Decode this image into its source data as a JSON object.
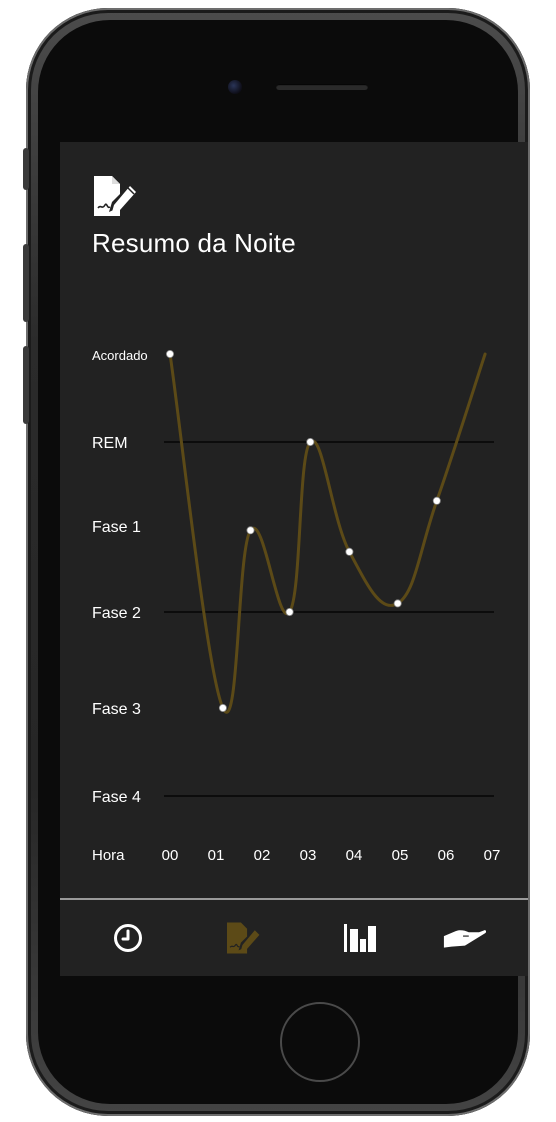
{
  "header": {
    "icon": "edit-document-icon",
    "title": "Resumo da Noite"
  },
  "colors": {
    "screen_bg": "#222222",
    "line": "#5c4a17",
    "point": "#ffffff",
    "grid": "#000000",
    "text": "#ffffff",
    "tab_active": "#5c4a17",
    "tab_inactive": "#ffffff"
  },
  "chart_data": {
    "type": "line",
    "x_label": "Hora",
    "x_ticks": [
      "00",
      "01",
      "02",
      "03",
      "04",
      "05",
      "06",
      "07"
    ],
    "y_categories": [
      "Fase 4",
      "Fase 3",
      "Fase 2",
      "Fase 1",
      "REM",
      "Acordado"
    ],
    "y_gridlines": [
      "Fase 4",
      "Fase 2",
      "REM"
    ],
    "series": [
      {
        "points": [
          {
            "x": 0.0,
            "y": 5.0
          },
          {
            "x": 1.15,
            "y": 1.0
          },
          {
            "x": 1.75,
            "y": 2.95
          },
          {
            "x": 2.6,
            "y": 2.0
          },
          {
            "x": 3.05,
            "y": 4.0
          },
          {
            "x": 3.9,
            "y": 2.7
          },
          {
            "x": 4.95,
            "y": 2.1
          },
          {
            "x": 5.8,
            "y": 3.3
          },
          {
            "x": 6.85,
            "y": 5.0
          }
        ],
        "marker_indices": [
          0,
          1,
          2,
          3,
          4,
          5,
          6,
          7
        ]
      }
    ]
  },
  "tabbar": {
    "tabs": [
      {
        "name": "tab-clock",
        "icon": "clock-icon",
        "active": false
      },
      {
        "name": "tab-summary",
        "icon": "edit-document-icon",
        "active": true
      },
      {
        "name": "tab-stats",
        "icon": "bar-chart-icon",
        "active": false
      },
      {
        "name": "tab-hand",
        "icon": "hand-icon",
        "active": false
      }
    ]
  }
}
